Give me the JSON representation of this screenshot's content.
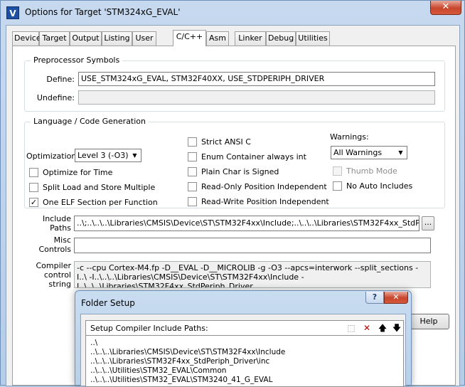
{
  "window": {
    "title": "Options for Target 'STM324xG_EVAL'",
    "close_glyph": "✕",
    "app_icon_glyph": "V"
  },
  "tabs": [
    {
      "label": "Device"
    },
    {
      "label": "Target"
    },
    {
      "label": "Output"
    },
    {
      "label": "Listing"
    },
    {
      "label": "User"
    },
    {
      "label": "C/C++"
    },
    {
      "label": "Asm"
    },
    {
      "label": "Linker"
    },
    {
      "label": "Debug"
    },
    {
      "label": "Utilities"
    }
  ],
  "active_tab": "C/C++",
  "preprocessor": {
    "title": "Preprocessor Symbols",
    "define_label": "Define:",
    "define_value": "USE_STM324xG_EVAL, STM32F40XX, USE_STDPERIPH_DRIVER",
    "undefine_label": "Undefine:",
    "undefine_value": ""
  },
  "language": {
    "title": "Language / Code Generation",
    "optimization_label": "Optimization:",
    "optimization_value": "Level 3 (-O3)",
    "checkboxes": [
      {
        "label": "Optimize for Time",
        "checked": false
      },
      {
        "label": "Split Load and Store Multiple",
        "checked": false
      },
      {
        "label": "One ELF Section per Function",
        "checked": true
      },
      {
        "label": "Strict ANSI C",
        "checked": false
      },
      {
        "label": "Enum Container always int",
        "checked": false
      },
      {
        "label": "Plain Char is Signed",
        "checked": false
      },
      {
        "label": "Read-Only Position Independent",
        "checked": false
      },
      {
        "label": "Read-Write Position Independent",
        "checked": false
      },
      {
        "label": "Thumb Mode",
        "checked": false,
        "disabled": true
      },
      {
        "label": "No Auto Includes",
        "checked": false
      }
    ],
    "warnings_label": "Warnings:",
    "warnings_value": "All Warnings"
  },
  "include_paths": {
    "label_line1": "Include",
    "label_line2": "Paths",
    "value": "..\\;..\\..\\..\\Libraries\\CMSIS\\Device\\ST\\STM32F4xx\\Include;..\\..\\..\\Libraries\\STM32F4xx_StdPeriph_",
    "browse_label": "..."
  },
  "misc_controls": {
    "label_line1": "Misc",
    "label_line2": "Controls",
    "value": ""
  },
  "compiler_string": {
    "label_line1": "Compiler",
    "label_line2": "control",
    "label_line3": "string",
    "value": "-c --cpu Cortex-M4.fp -D__EVAL -D__MICROLIB -g -O3 --apcs=interwork --split_sections -I..\\ -I..\\..\\..\\Libraries\\CMSIS\\Device\\ST\\STM32F4xx\\Include -I..\\..\\..\\Libraries\\STM32F4xx_StdPeriph_Driver"
  },
  "buttons": {
    "help_label": "Help"
  },
  "folder_setup": {
    "title": "Folder Setup",
    "help_glyph": "?",
    "close_glyph": "✕",
    "header": "Setup Compiler Include Paths:",
    "toolbar": {
      "new_glyph": "⬚",
      "delete_glyph": "✕",
      "up_glyph": "🡅",
      "down_glyph": "🡇"
    },
    "paths": [
      "..\\",
      "..\\..\\..\\Libraries\\CMSIS\\Device\\ST\\STM32F4xx\\Include",
      "..\\..\\..\\Libraries\\STM32F4xx_StdPeriph_Driver\\inc",
      "..\\..\\..\\Utilities\\STM32_EVAL\\Common",
      "..\\..\\..\\Utilities\\STM32_EVAL\\STM3240_41_G_EVAL"
    ]
  },
  "colors": {
    "close_red": "#c7452c",
    "delete_red": "#c00000"
  }
}
